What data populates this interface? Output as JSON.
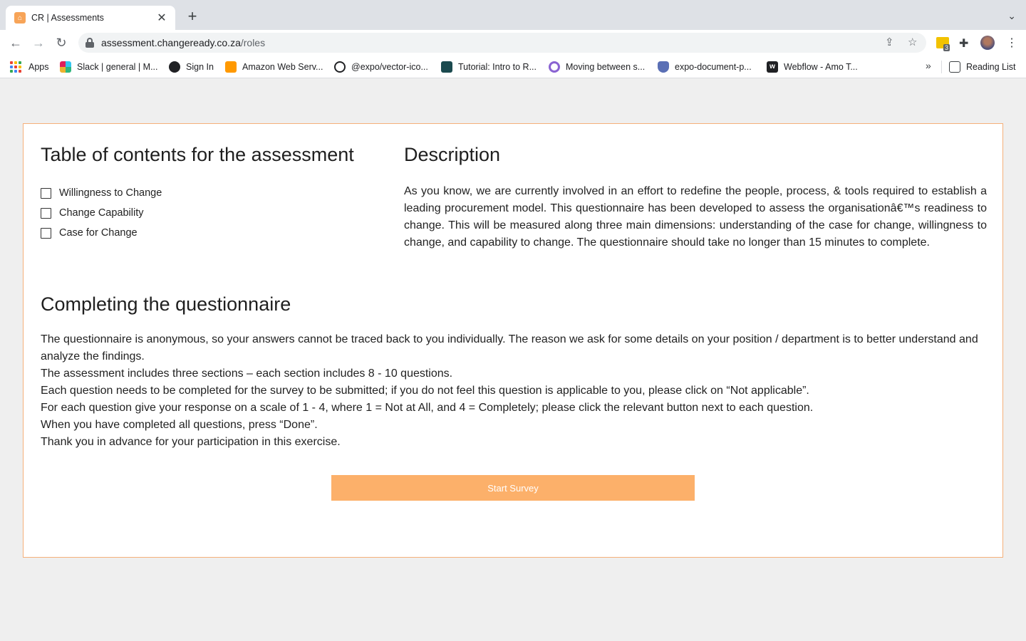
{
  "browser": {
    "tab_title": "CR | Assessments",
    "tab_close": "✕",
    "new_tab": "+",
    "url_host": "assessment.changeready.co.za",
    "url_path": "/roles",
    "extension_count": "3"
  },
  "bookmarks": [
    {
      "label": "Apps",
      "icon": "apps-grid-icon"
    },
    {
      "label": "Slack | general | M...",
      "icon": "slack-icon",
      "color": "#e01e5a"
    },
    {
      "label": "Sign In",
      "icon": "globe-icon",
      "color": "#202124"
    },
    {
      "label": "Amazon Web Serv...",
      "icon": "aws-cube-icon",
      "color": "#f90"
    },
    {
      "label": "@expo/vector-ico...",
      "icon": "expo-icon",
      "color": "#202124"
    },
    {
      "label": "Tutorial: Intro to R...",
      "icon": "react-icon",
      "color": "#1b4a4f"
    },
    {
      "label": "Moving between s...",
      "icon": "circle-icon",
      "color": "#8a63d2"
    },
    {
      "label": "expo-document-p...",
      "icon": "shield-icon",
      "color": "#5a6fb5"
    },
    {
      "label": "Webflow - Amo T...",
      "icon": "webflow-icon",
      "color": "#202124"
    }
  ],
  "reading_list": "Reading List",
  "toc": {
    "title": "Table of contents for the assessment",
    "items": [
      "Willingness to Change",
      "Change Capability",
      "Case for Change"
    ]
  },
  "description": {
    "title": "Description",
    "text": "As you know, we are currently involved in an effort to redefine the people, process, & tools required to establish a leading procurement model. This questionnaire has been developed to assess the organisationâ€™s readiness to change. This will be measured along three main dimensions: understanding of the case for change, willingness to change, and capability to change. The questionnaire should take no longer than 15 minutes to complete."
  },
  "completing": {
    "title": "Completing the questionnaire",
    "paragraphs": [
      "The questionnaire is anonymous, so your answers cannot be traced back to you individually. The reason we ask for some details on your position / department is to better understand and analyze the findings.",
      "The assessment includes three sections – each section includes 8 - 10 questions.",
      "Each question needs to be completed for the survey to be submitted; if you do not feel this question is applicable to you, please click on “Not applicable”.",
      "For each question give your response on a scale of 1 - 4, where 1 = Not at All, and 4 = Completely; please click the relevant button next to each question.",
      "When you have completed all questions, press “Done”.",
      "Thank you in advance for your participation in this exercise."
    ]
  },
  "start_button": "Start Survey",
  "colors": {
    "accent": "#fcb06a",
    "border": "#f5b07a"
  }
}
